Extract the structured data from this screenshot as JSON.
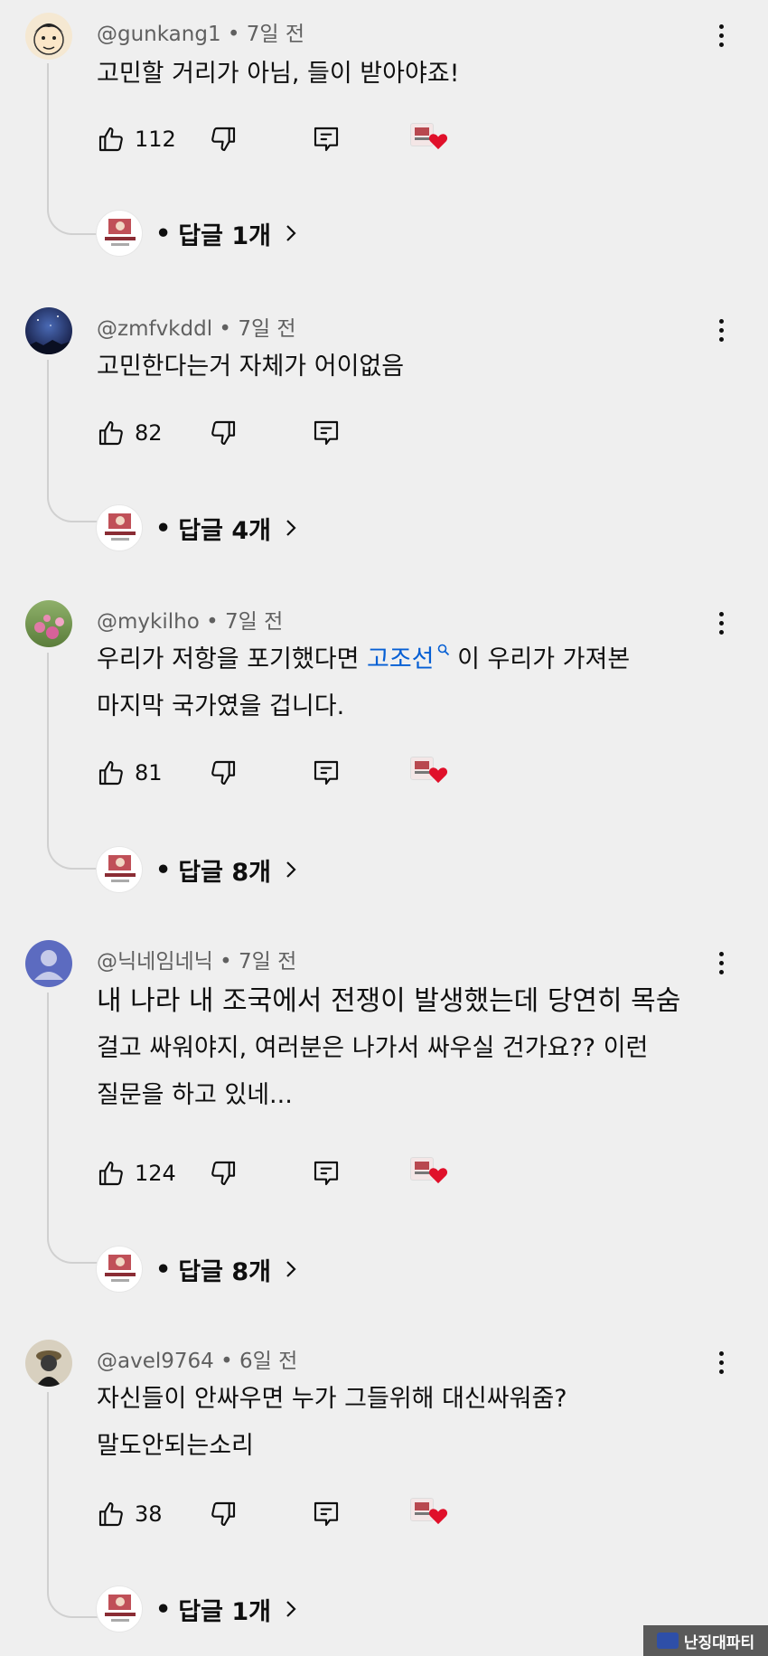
{
  "comments": [
    {
      "handle": "@gunkang1",
      "time": "7일 전",
      "lines": [
        "고민할 거리가 아님, 들이 받아야죠!"
      ],
      "likes": "112",
      "creator_heart": true,
      "replies": "답글 1개",
      "avatar": "cartoon-face"
    },
    {
      "handle": "@zmfvkddl",
      "time": "7일 전",
      "lines": [
        "고민한다는거 자체가 어이없음"
      ],
      "likes": "82",
      "creator_heart": false,
      "replies": "답글 4개",
      "avatar": "night-sky"
    },
    {
      "handle": "@mykilho",
      "time": "7일 전",
      "line1_before": "우리가 저항을 포기했다면 ",
      "line1_link": "고조선",
      "line1_after": " 이 우리가 가져본",
      "line2": "마지막 국가였을 겁니다.",
      "likes": "81",
      "creator_heart": true,
      "replies": "답글 8개",
      "avatar": "flowers"
    },
    {
      "handle": "@닉네임네닉",
      "time": "7일 전",
      "lines": [
        "내 나라 내 조국에서 전쟁이 발생했는데 당연히 목숨",
        "걸고 싸워야지, 여러분은 나가서 싸우실 건가요?? 이런",
        "질문을 하고 있네..."
      ],
      "likes": "124",
      "creator_heart": true,
      "replies": "답글 8개",
      "avatar": "default-person"
    },
    {
      "handle": "@avel9764",
      "time": "6일 전",
      "lines": [
        "자신들이 안싸우면 누가 그들위해 대신싸워줌?",
        "말도안되는소리"
      ],
      "likes": "38",
      "creator_heart": true,
      "replies": "답글 1개",
      "avatar": "dark-photo"
    }
  ],
  "separator": "•",
  "watermark": "난징대파티",
  "colors": {
    "link": "#065fd4",
    "heart": "#e0102a",
    "secondary_text": "#606060",
    "background": "#efefef"
  },
  "icons": [
    "like-icon",
    "dislike-icon",
    "reply-icon",
    "more-icon",
    "chevron-right-icon",
    "search-icon"
  ]
}
